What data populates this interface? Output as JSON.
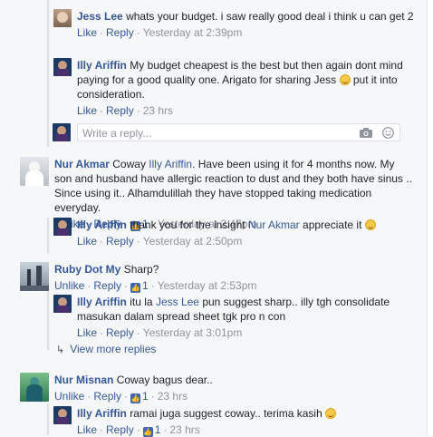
{
  "comments": [
    {
      "author": "Jess Lee",
      "text": "whats your budget. i saw really good deal i think u can get 2",
      "meta": {
        "like": "Like",
        "reply": "Reply",
        "time": "Yesterday at 2:39pm"
      }
    },
    {
      "author": "Illy Ariffin",
      "text": "My budget cheapest is the best but then again dont mind paying for a good quality one. Arigato for sharing Jess",
      "text2": "put it into consideration.",
      "meta": {
        "like": "Like",
        "reply": "Reply",
        "time": "23 hrs"
      }
    },
    {
      "author": "Nur Akmar",
      "text_pre": "Coway",
      "mention": "Illy Ariffin",
      "text": ". Have been using it for 4 months now. My son and husband have allergic reaction to dust and they both have sinus .. Since using it.. Alhamdulillah they have stopped taking medication everyday.",
      "meta": {
        "unlike": "Unlike",
        "reply": "Reply",
        "likes": "1",
        "time": "Yesterday at 2:47pm"
      }
    },
    {
      "author": "Illy Ariffin",
      "text_pre": "thank you for the insight",
      "mention": "Nur Akmar",
      "text": "appreciate it",
      "meta": {
        "like": "Like",
        "reply": "Reply",
        "time": "Yesterday at 2:50pm"
      }
    },
    {
      "author": "Ruby Dot My",
      "text": "Sharp?",
      "meta": {
        "unlike": "Unlike",
        "reply": "Reply",
        "likes": "1",
        "time": "Yesterday at 2:53pm"
      }
    },
    {
      "author": "Illy Ariffin",
      "text_pre": "itu la",
      "mention": "Jess Lee",
      "text": "pun suggest sharp.. illy tgh consolidate masukan dalam spread sheet tgk pro n con",
      "meta": {
        "like": "Like",
        "reply": "Reply",
        "time": "Yesterday at 3:01pm"
      }
    },
    {
      "author": "Nur Misnan",
      "text": "Coway bagus dear..",
      "meta": {
        "unlike": "Unlike",
        "reply": "Reply",
        "likes": "1",
        "time": "23 hrs"
      }
    },
    {
      "author": "Illy Ariffin",
      "text": "ramai juga suggest coway.. terima kasih",
      "meta": {
        "like": "Like",
        "reply": "Reply",
        "likes": "1",
        "time": "23 hrs"
      }
    }
  ],
  "reply_box": {
    "placeholder": "Write a reply..."
  },
  "view_more": "View more replies",
  "icons": {
    "camera": "camera-icon",
    "emoji": "emoji-icon",
    "thumbs_up": "thumbs-up-icon",
    "smiley": "smiley-emoji",
    "reply_arrow": "reply-arrow-icon"
  },
  "colors": {
    "link": "#365899",
    "meta": "#90949c",
    "background": "#f6f7f9",
    "thumb": "#4267b2"
  }
}
